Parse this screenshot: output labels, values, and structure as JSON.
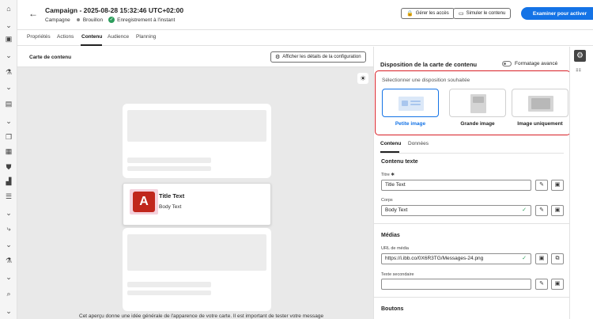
{
  "header": {
    "title": "Campaign - 2025-08-28 15:32:46 UTC+02:00",
    "breadcrumb": "Campagne",
    "status": "Brouillon",
    "schedule": "Enregistrement à l'instant",
    "manage_access": "Gérer les accès",
    "simulate": "Simuler le contenu",
    "review": "Examiner pour activer"
  },
  "tabs": [
    "Propriétés",
    "Actions",
    "Contenu",
    "Audience",
    "Planning"
  ],
  "preview": {
    "label": "Carte de contenu",
    "config_button": "Afficher les détails de la configuration",
    "card_title": "Title Text",
    "card_body": "Body Text",
    "note": "Cet aperçu donne une idée générale de l'apparence de votre carte. Il est important de tester votre message"
  },
  "panel": {
    "title": "Disposition de la carte de contenu",
    "advanced_toggle": "Formatage avancé",
    "layout_hint": "Sélectionner une disposition souhaitée",
    "layouts": [
      "Petite image",
      "Grande image",
      "Image uniquement"
    ],
    "selected_layout": "Petite image",
    "subtabs": [
      "Contenu",
      "Données"
    ],
    "text_section": "Contenu texte",
    "title_label": "Titre",
    "title_value": "Title Text",
    "body_label": "Corps",
    "body_value": "Body Text",
    "media_section": "Médias",
    "media_url_label": "URL de média",
    "media_url_value": "https://i.ibb.co/0X6R3TG/Messages-24.png",
    "secondary_label": "Texte secondaire",
    "secondary_value": "",
    "buttons_section": "Boutons"
  },
  "icons": {
    "rail": [
      "home-icon",
      "chevron-down-icon",
      "campaign-icon",
      "chevron-down-icon",
      "flask-icon",
      "chevron-down-icon",
      "table-icon",
      "chevron-down-icon",
      "copy-icon",
      "journey-icon",
      "badge-icon",
      "chart-icon",
      "list-icon",
      "chevron-down-icon",
      "branch-icon",
      "chevron-down-icon",
      "flask-icon",
      "chevron-down-icon",
      "search-icon",
      "chevron-down-icon"
    ]
  },
  "colors": {
    "accent": "#1473e6",
    "highlight": "#d81f26",
    "success": "#2d9d5c"
  }
}
